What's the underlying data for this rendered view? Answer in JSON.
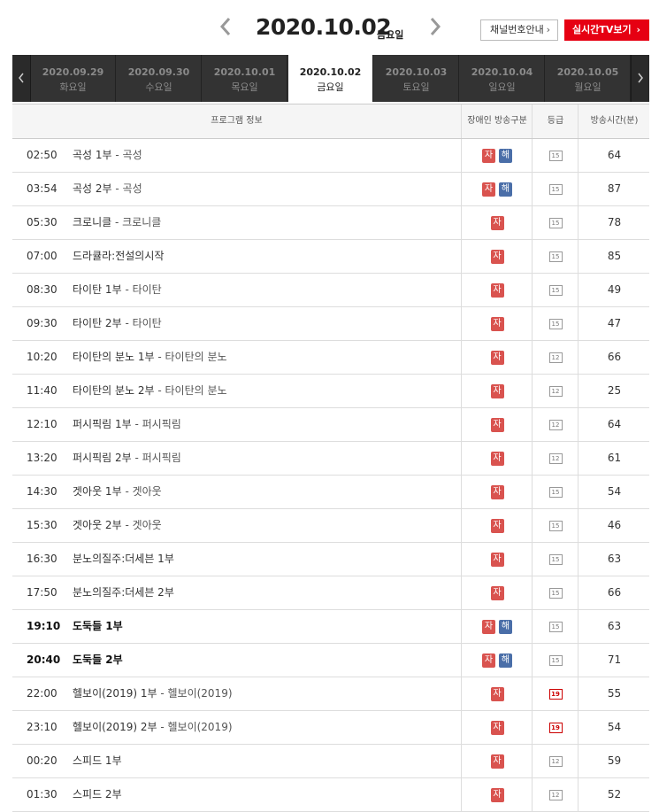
{
  "header": {
    "date": "2020.10.02",
    "weekday": "금요일",
    "channel_button": "채널번호안내",
    "live_button": "실시간TV보기"
  },
  "date_tabs": [
    {
      "date": "2020.09.29",
      "weekday": "화요일",
      "active": false
    },
    {
      "date": "2020.09.30",
      "weekday": "수요일",
      "active": false
    },
    {
      "date": "2020.10.01",
      "weekday": "목요일",
      "active": false
    },
    {
      "date": "2020.10.02",
      "weekday": "금요일",
      "active": true
    },
    {
      "date": "2020.10.03",
      "weekday": "토요일",
      "active": false
    },
    {
      "date": "2020.10.04",
      "weekday": "일요일",
      "active": false
    },
    {
      "date": "2020.10.05",
      "weekday": "월요일",
      "active": false
    }
  ],
  "table": {
    "headers": {
      "program": "프로그램 정보",
      "accessibility": "장애인 방송구분",
      "grade": "등급",
      "duration": "방송시간(분)"
    },
    "rows": [
      {
        "time": "02:50",
        "title": "곡성 1부",
        "sub": "곡성",
        "ja": "자",
        "hae": "해",
        "grade": "15",
        "duration": "64",
        "bold": false
      },
      {
        "time": "03:54",
        "title": "곡성 2부",
        "sub": "곡성",
        "ja": "자",
        "hae": "해",
        "grade": "15",
        "duration": "87",
        "bold": false
      },
      {
        "time": "05:30",
        "title": "크로니클",
        "sub": "크로니클",
        "ja": "자",
        "hae": "",
        "grade": "15",
        "duration": "78",
        "bold": false
      },
      {
        "time": "07:00",
        "title": "드라큘라:전설의시작",
        "sub": "",
        "ja": "자",
        "hae": "",
        "grade": "15",
        "duration": "85",
        "bold": false
      },
      {
        "time": "08:30",
        "title": "타이탄 1부",
        "sub": "타이탄",
        "ja": "자",
        "hae": "",
        "grade": "15",
        "duration": "49",
        "bold": false
      },
      {
        "time": "09:30",
        "title": "타이탄 2부",
        "sub": "타이탄",
        "ja": "자",
        "hae": "",
        "grade": "15",
        "duration": "47",
        "bold": false
      },
      {
        "time": "10:20",
        "title": "타이탄의 분노 1부",
        "sub": "타이탄의 분노",
        "ja": "자",
        "hae": "",
        "grade": "12",
        "duration": "66",
        "bold": false
      },
      {
        "time": "11:40",
        "title": "타이탄의 분노 2부",
        "sub": "타이탄의 분노",
        "ja": "자",
        "hae": "",
        "grade": "12",
        "duration": "25",
        "bold": false
      },
      {
        "time": "12:10",
        "title": "퍼시픽림 1부",
        "sub": "퍼시픽림",
        "ja": "자",
        "hae": "",
        "grade": "12",
        "duration": "64",
        "bold": false
      },
      {
        "time": "13:20",
        "title": "퍼시픽림 2부",
        "sub": "퍼시픽림",
        "ja": "자",
        "hae": "",
        "grade": "12",
        "duration": "61",
        "bold": false
      },
      {
        "time": "14:30",
        "title": "겟아웃 1부",
        "sub": "겟아웃",
        "ja": "자",
        "hae": "",
        "grade": "15",
        "duration": "54",
        "bold": false
      },
      {
        "time": "15:30",
        "title": "겟아웃 2부",
        "sub": "겟아웃",
        "ja": "자",
        "hae": "",
        "grade": "15",
        "duration": "46",
        "bold": false
      },
      {
        "time": "16:30",
        "title": "분노의질주:더세븐 1부",
        "sub": "",
        "ja": "자",
        "hae": "",
        "grade": "15",
        "duration": "63",
        "bold": false
      },
      {
        "time": "17:50",
        "title": "분노의질주:더세븐 2부",
        "sub": "",
        "ja": "자",
        "hae": "",
        "grade": "15",
        "duration": "66",
        "bold": false
      },
      {
        "time": "19:10",
        "title": "도둑들 1부",
        "sub": "",
        "ja": "자",
        "hae": "해",
        "grade": "15",
        "duration": "63",
        "bold": true
      },
      {
        "time": "20:40",
        "title": "도둑들 2부",
        "sub": "",
        "ja": "자",
        "hae": "해",
        "grade": "15",
        "duration": "71",
        "bold": true
      },
      {
        "time": "22:00",
        "title": "헬보이(2019) 1부",
        "sub": "헬보이(2019)",
        "ja": "자",
        "hae": "",
        "grade": "19",
        "duration": "55",
        "bold": false
      },
      {
        "time": "23:10",
        "title": "헬보이(2019) 2부",
        "sub": "헬보이(2019)",
        "ja": "자",
        "hae": "",
        "grade": "19",
        "duration": "54",
        "bold": false
      },
      {
        "time": "00:20",
        "title": "스피드 1부",
        "sub": "",
        "ja": "자",
        "hae": "",
        "grade": "12",
        "duration": "59",
        "bold": false
      },
      {
        "time": "01:30",
        "title": "스피드 2부",
        "sub": "",
        "ja": "자",
        "hae": "",
        "grade": "12",
        "duration": "52",
        "bold": false
      }
    ]
  }
}
